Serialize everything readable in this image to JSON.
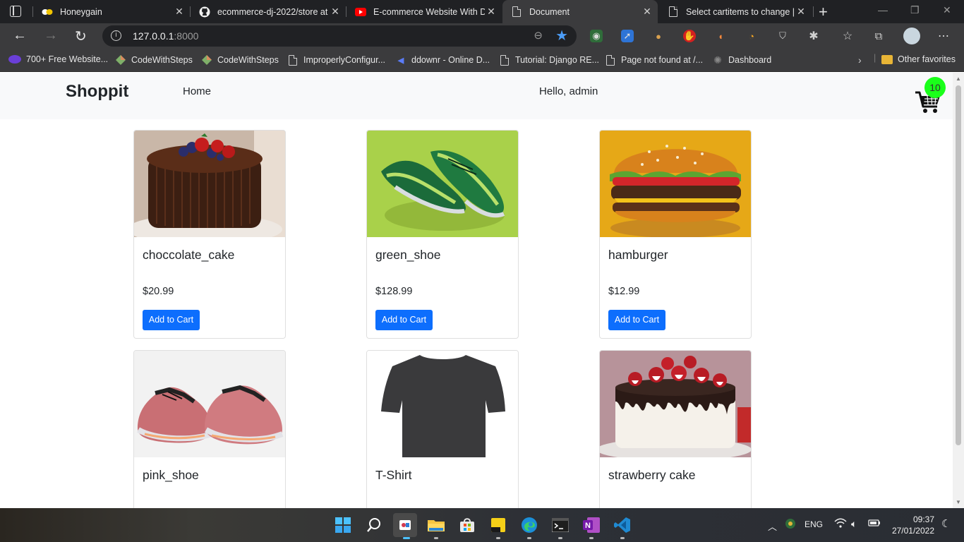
{
  "browser": {
    "tabs": [
      {
        "title": "Honeygain",
        "icon": "honeygain-icon",
        "active": false
      },
      {
        "title": "ecommerce-dj-2022/store at",
        "icon": "github-icon",
        "active": false
      },
      {
        "title": "E-commerce Website With Dj",
        "icon": "youtube-icon",
        "active": false
      },
      {
        "title": "Document",
        "icon": "document-icon",
        "active": true
      },
      {
        "title": "Select cartitems to change | D",
        "icon": "document-icon",
        "active": false
      }
    ],
    "address": {
      "host": "127.0.0.1",
      "port": ":8000"
    },
    "bookmarks": [
      "700+ Free Website...",
      "CodeWithSteps",
      "CodeWithSteps",
      "ImproperlyConfigur...",
      "ddownr - Online D...",
      "Tutorial: Django RE...",
      "Page not found at /...",
      "Dashboard"
    ],
    "other_favorites": "Other favorites"
  },
  "page": {
    "brand": "Shoppit",
    "nav_home": "Home",
    "greeting": "Hello, admin",
    "cart_count": "10",
    "add_to_cart_label": "Add to Cart",
    "products": [
      {
        "name": "choccolate_cake",
        "price": "$20.99"
      },
      {
        "name": "green_shoe",
        "price": "$128.99"
      },
      {
        "name": "hamburger",
        "price": "$12.99"
      },
      {
        "name": "pink_shoe",
        "price": ""
      },
      {
        "name": "T-Shirt",
        "price": ""
      },
      {
        "name": "strawberry cake",
        "price": ""
      }
    ],
    "colors": {
      "primary_button": "#0d6efd",
      "badge": "#1aff1a",
      "navbar_bg": "#f8f9fa"
    }
  },
  "taskbar": {
    "language": "ENG",
    "time": "09:37",
    "date": "27/01/2022"
  }
}
